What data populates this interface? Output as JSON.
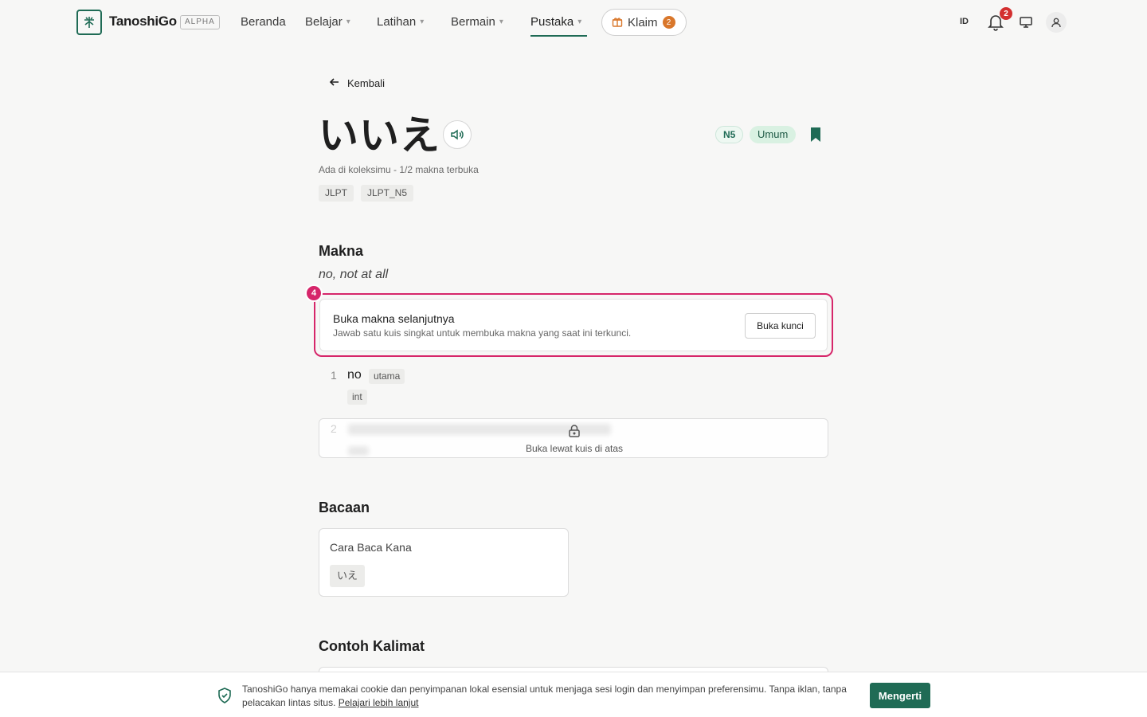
{
  "nav": {
    "brand": "TanoshiGo",
    "badge": "ALPHA",
    "links": [
      {
        "label": "Beranda"
      },
      {
        "label": "Belajar"
      },
      {
        "label": "Latihan"
      },
      {
        "label": "Bermain"
      },
      {
        "label": "Pustaka"
      }
    ],
    "claim": {
      "label": "Klaim",
      "count": "2"
    },
    "language": "ID",
    "notification_count": "2"
  },
  "page": {
    "back_label": "Kembali",
    "word": "いいえ",
    "level_badge": "N5",
    "category_badge": "Umum",
    "status": "Ada di koleksimu - 1/2 makna terbuka",
    "tags": [
      "JLPT",
      "JLPT_N5"
    ]
  },
  "meaning": {
    "heading": "Makna",
    "summary": "no, not at all",
    "step_marker": "4",
    "unlock": {
      "title": "Buka makna selanjutnya",
      "description": "Jawab satu kuis singkat untuk membuka makna yang saat ini terkunci.",
      "button": "Buka kunci"
    },
    "items": [
      {
        "number": "1",
        "word": "no",
        "label": "utama",
        "pos": "int"
      },
      {
        "number": "2",
        "locked_text": "Buka lewat kuis di atas"
      }
    ]
  },
  "reading": {
    "heading": "Bacaan",
    "label": "Cara Baca Kana",
    "kana": "いえ"
  },
  "examples": {
    "heading": "Contoh Kalimat"
  },
  "cookie": {
    "text": "TanoshiGo hanya memakai cookie dan penyimpanan lokal esensial untuk menjaga sesi login dan menyimpan preferensimu. Tanpa iklan, tanpa pelacakan lintas situs.",
    "link": "Pelajari lebih lanjut",
    "button": "Mengerti"
  },
  "colors": {
    "brand": "#1f6b55",
    "highlight": "#d6266a",
    "claim_accent": "#d9772b",
    "notification": "#d32f2f"
  },
  "icons": [
    "app-logo-icon",
    "chevron-down-icon",
    "gift-icon",
    "bell-icon",
    "monitor-icon",
    "user-icon",
    "arrow-left-icon",
    "speaker-icon",
    "bookmark-icon",
    "lock-icon",
    "shield-check-icon"
  ]
}
